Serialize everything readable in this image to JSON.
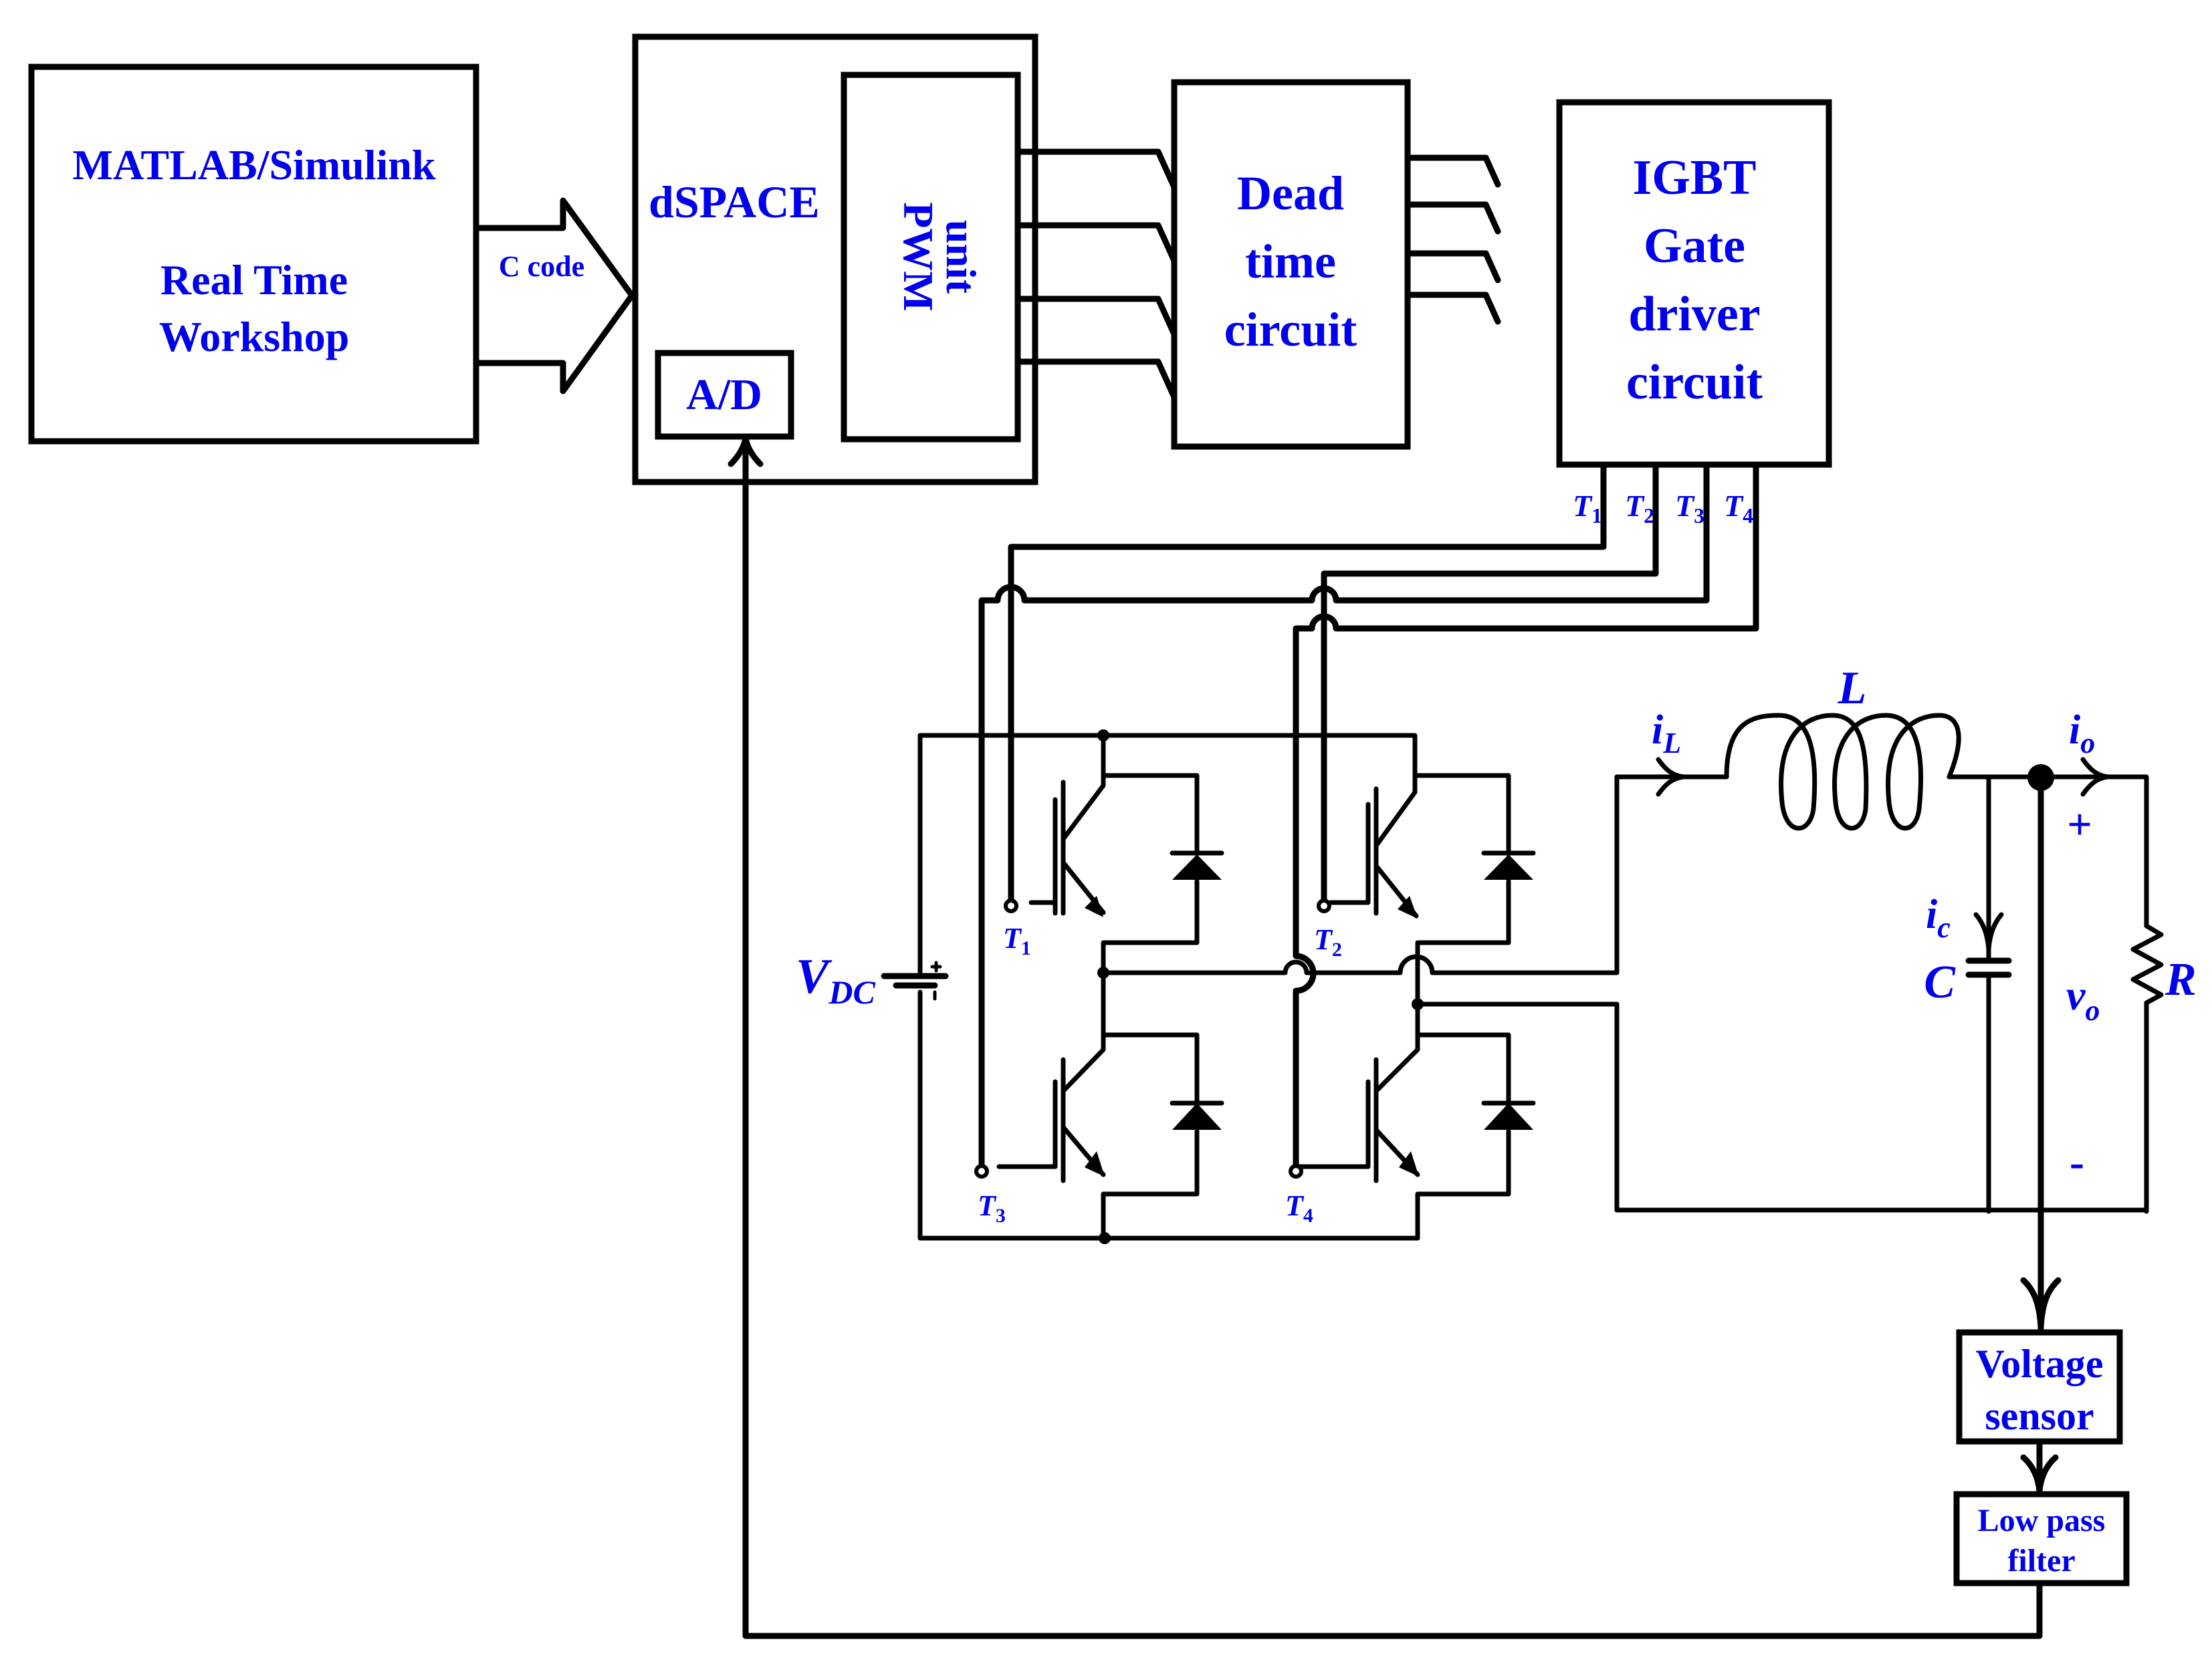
{
  "blocks": {
    "matlab": {
      "line1": "MATLAB/Simulink",
      "line2": "Real Time",
      "line3": "Workshop"
    },
    "arrow_label": "C code",
    "dspace": {
      "title": "dSPACE",
      "pwm_line1": "PWM",
      "pwm_line2": "unit",
      "ad": "A/D"
    },
    "dead_time": {
      "line1": "Dead",
      "line2": "time",
      "line3": "circuit"
    },
    "igbt_driver": {
      "line1": "IGBT",
      "line2": "Gate",
      "line3": "driver",
      "line4": "circuit"
    },
    "voltage_sensor": {
      "line1": "Voltage",
      "line2": "sensor"
    },
    "low_pass_filter": {
      "line1": "Low pass",
      "line2": "filter"
    }
  },
  "gate_signals": [
    {
      "base": "T",
      "sub": "1"
    },
    {
      "base": "T",
      "sub": "2"
    },
    {
      "base": "T",
      "sub": "3"
    },
    {
      "base": "T",
      "sub": "4"
    }
  ],
  "circuit": {
    "source": {
      "base": "V",
      "sub": "DC",
      "plus": "+",
      "minus": "-"
    },
    "inductor": "L",
    "inductor_current": {
      "base": "i",
      "sub": "L"
    },
    "capacitor": "C",
    "capacitor_current": {
      "base": "i",
      "sub": "c"
    },
    "resistor": "R",
    "output_current": {
      "base": "i",
      "sub": "o"
    },
    "output_voltage": {
      "base": "v",
      "sub": "o"
    },
    "plus": "+",
    "minus": "-"
  },
  "colors": {
    "label": "#0000ee",
    "wire": "#000000"
  }
}
